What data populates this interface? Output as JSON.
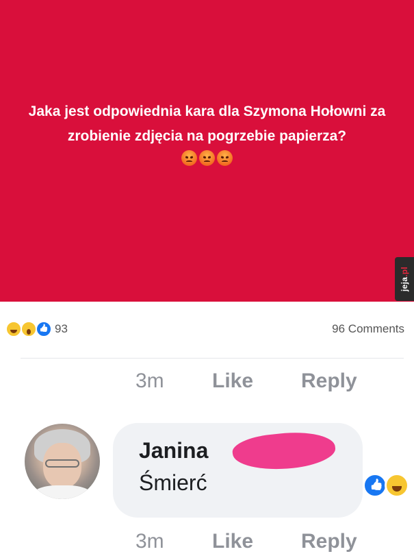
{
  "post": {
    "text": "Jaka jest odpowiednia kara dla Szymona Hołowni za zrobienie zdjęcia na pogrzebie papierza?",
    "background_color": "#d90f3b",
    "emoji_reactions": [
      "angry-face-icon",
      "angry-face-icon",
      "angry-face-icon"
    ]
  },
  "watermark": {
    "brand": "jeja",
    "tld": ".pl"
  },
  "reactions": {
    "icons": [
      "haha-reaction-icon",
      "wow-reaction-icon",
      "like-reaction-icon"
    ],
    "count": "93",
    "comments": "96 Comments"
  },
  "action_rows": [
    {
      "time": "3m",
      "like": "Like",
      "reply": "Reply"
    },
    {
      "time": "3m",
      "like": "Like",
      "reply": "Reply"
    }
  ],
  "comment": {
    "author": "Janina",
    "text": "Śmierć",
    "reactions": [
      "like-reaction-icon",
      "haha-reaction-icon"
    ]
  },
  "colors": {
    "accent_like": "#1877f2",
    "muted_text": "#8f9299",
    "bubble": "#f0f2f5",
    "redaction": "#ef2c83"
  }
}
